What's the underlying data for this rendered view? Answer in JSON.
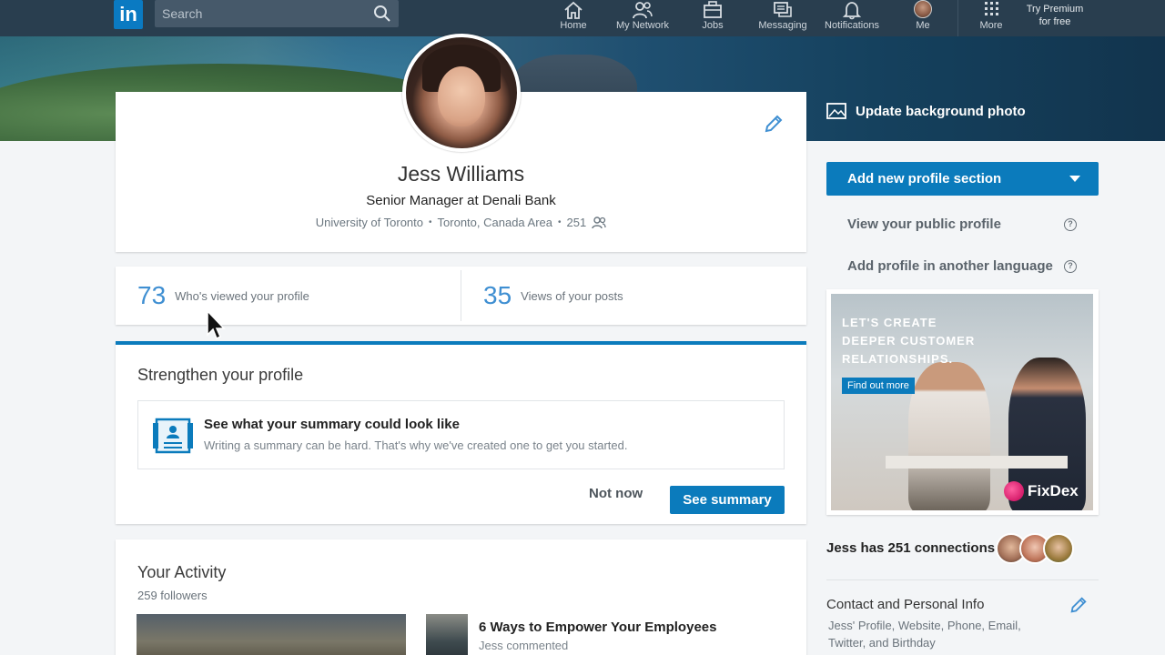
{
  "nav": {
    "logo": "in",
    "search_placeholder": "Search",
    "items": [
      {
        "label": "Home"
      },
      {
        "label": "My Network"
      },
      {
        "label": "Jobs"
      },
      {
        "label": "Messaging"
      },
      {
        "label": "Notifications"
      },
      {
        "label": "Me"
      },
      {
        "label": "More"
      }
    ],
    "premium_line1": "Try Premium",
    "premium_line2": "for free"
  },
  "banner": {
    "update_bg_label": "Update background photo"
  },
  "profile": {
    "name": "Jess Williams",
    "headline": "Senior Manager at Denali Bank",
    "school": "University of Toronto",
    "location": "Toronto, Canada Area",
    "connections_count": "251"
  },
  "stats": {
    "profile_views": "73",
    "profile_views_label": "Who's viewed your profile",
    "post_views": "35",
    "post_views_label": "Views of your posts"
  },
  "strengthen": {
    "title": "Strengthen your profile",
    "summary_title": "See what your summary could look like",
    "summary_desc": "Writing a summary can be hard. That's why we've created one to get you started.",
    "not_now": "Not now",
    "see_summary": "See summary"
  },
  "activity": {
    "title": "Your Activity",
    "followers": "259 followers",
    "post_title": "6 Ways to Empower Your Employees",
    "post_sub": "Jess commented"
  },
  "sidebar": {
    "add_section": "Add new profile section",
    "view_public": "View your public profile",
    "add_language": "Add profile in another language",
    "help_glyph": "?",
    "ad_text": "LET'S CREATE DEEPER CUSTOMER RELATIONSHIPS.",
    "ad_button": "Find out more",
    "ad_brand": "FixDex",
    "connections_text": "Jess has 251 connections",
    "contact_title": "Contact and Personal Info",
    "contact_desc": "Jess' Profile, Website, Phone, Email, Twitter, and Birthday"
  },
  "colors": {
    "nav_bg": "#293e4f",
    "accent": "#0b7bbc",
    "stat_number": "#3f8fd2",
    "page_bg": "#f3f5f7"
  },
  "icons": [
    "search-icon",
    "home-icon",
    "network-icon",
    "jobs-icon",
    "messaging-icon",
    "notifications-icon",
    "grid-icon",
    "image-icon",
    "pencil-icon",
    "connections-icon",
    "summary-icon",
    "help-icon",
    "chevron-down-icon"
  ]
}
